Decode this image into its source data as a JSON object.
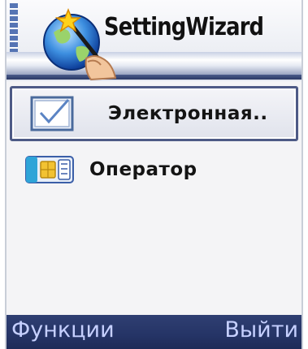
{
  "header": {
    "app_title": "SettingWizard",
    "icon": "globe-wand-icon"
  },
  "list": {
    "items": [
      {
        "label": "Электронная..",
        "icon": "checkbox-icon",
        "selected": true
      },
      {
        "label": "Оператор",
        "icon": "sim-card-icon",
        "selected": false
      }
    ]
  },
  "softkeys": {
    "left": "Функции",
    "right": "Выйти"
  },
  "colors": {
    "softkey_bg": "#253466",
    "softkey_text": "#c6d0ff",
    "selection_border": "#4d5a86"
  }
}
